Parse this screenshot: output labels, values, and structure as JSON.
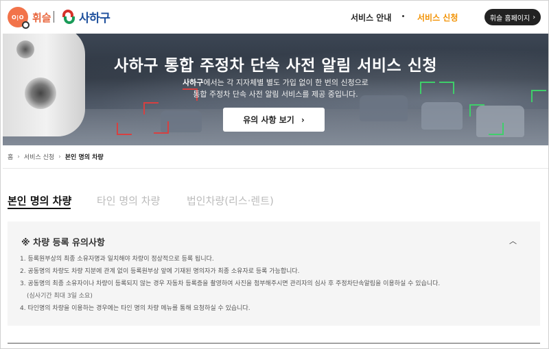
{
  "header": {
    "logo_huisle_mark": "O|O",
    "logo_huisle_text": "휘슬",
    "logo_saha_text": "사하구",
    "nav": {
      "guide": "서비스 안내",
      "apply": "서비스 신청"
    },
    "home_button": "휘슬 홈페이지",
    "home_button_icon": "chevron-right-icon",
    "accent_color": "#f29100"
  },
  "banner": {
    "title": "사하구 통합 주정차 단속 사전 알림 서비스 신청",
    "desc_bold": "사하구",
    "desc_line1_rest": "에서는 각 지자체별 별도 가입 없이 한 번의 신청으로",
    "desc_line2": "통합 주정차 단속 사전 알림 서비스를 제공 중입니다.",
    "notice_button": "유의 사항 보기",
    "notice_button_icon": "chevron-right-icon"
  },
  "breadcrumb": {
    "home": "홈",
    "service_apply": "서비스 신청",
    "current": "본인 명의 차량"
  },
  "tabs": [
    {
      "label": "본인 명의 차량",
      "active": true
    },
    {
      "label": "타인 명의 차량",
      "active": false
    },
    {
      "label": "법인차량(리스·렌트)",
      "active": false
    }
  ],
  "notice_panel": {
    "title": "※ 차량 등록 유의사항",
    "collapse_icon": "chevron-up-icon",
    "items": [
      "1. 등록원부상의 최종 소유자명과 일치해야 차량이 정상적으로 등록 됩니다.",
      "2. 공동명의 차량도 차량 지분에 관계 없이 등록원부상 앞에 기재된 명의자가 최종 소유자로 등록 가능합니다.",
      "3. 공동명의 최종 소유자이나 차량이 등록되지 않는 경우 자동차 등록증을 촬영하여 사진을 첨부해주시면 관리자의 심사 후 주정차단속알림을 이용하실 수 있습니다.",
      "(심사기간 최대 3일 소요)",
      "4. 타인명의 차량을 이용하는 경우에는 타인 명의 차량 메뉴를 통해 요청하실 수 있습니다."
    ]
  }
}
